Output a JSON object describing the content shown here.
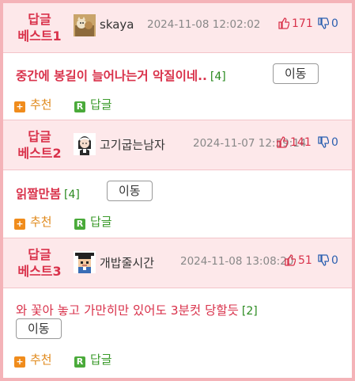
{
  "posts": [
    {
      "rank_line1": "답글",
      "rank_line2": "베스트1",
      "avatar_icon": "cat-photo-avatar-icon",
      "nickname": "skaya",
      "date": "2024-11-08 12:02:02",
      "up_count": "171",
      "down_count": "0",
      "title": "중간에 봉길이 늘어나는거 악질이네..",
      "comment_count": "[4]",
      "move_label": "이동",
      "recommend_label": "추천",
      "reply_label": "답글"
    },
    {
      "rank_line1": "답글",
      "rank_line2": "베스트2",
      "avatar_icon": "maid-avatar-icon",
      "nickname": "고기굽는남자",
      "date": "2024-11-07 12:59:14",
      "up_count": "141",
      "down_count": "0",
      "title": "읽짤만봄",
      "comment_count": "[4]",
      "move_label": "이동",
      "recommend_label": "추천",
      "reply_label": "답글"
    },
    {
      "rank_line1": "답글",
      "rank_line2": "베스트3",
      "avatar_icon": "pixel-graduate-avatar-icon",
      "nickname": "개밥줄시간",
      "date": "2024-11-08 13:08:20",
      "up_count": "51",
      "down_count": "0",
      "title": "와 꽃아 놓고 가만히만 있어도 3분컷 당할듯",
      "comment_count": "[2]",
      "move_label": "이동",
      "recommend_label": "추천",
      "reply_label": "답글"
    }
  ],
  "icons": {
    "thumb_up": "thumbs-up-icon",
    "thumb_down": "thumbs-down-icon",
    "recommend_badge": "+",
    "reply_badge": "R"
  },
  "colors": {
    "accent_red": "#d9324b",
    "header_bg": "#fde8ea",
    "border_pink": "#f4b3b8",
    "down_blue": "#2b5fb0",
    "comment_green": "#2a8a1f",
    "recommend_orange": "#f08c1c",
    "reply_green": "#4aaa3a"
  }
}
